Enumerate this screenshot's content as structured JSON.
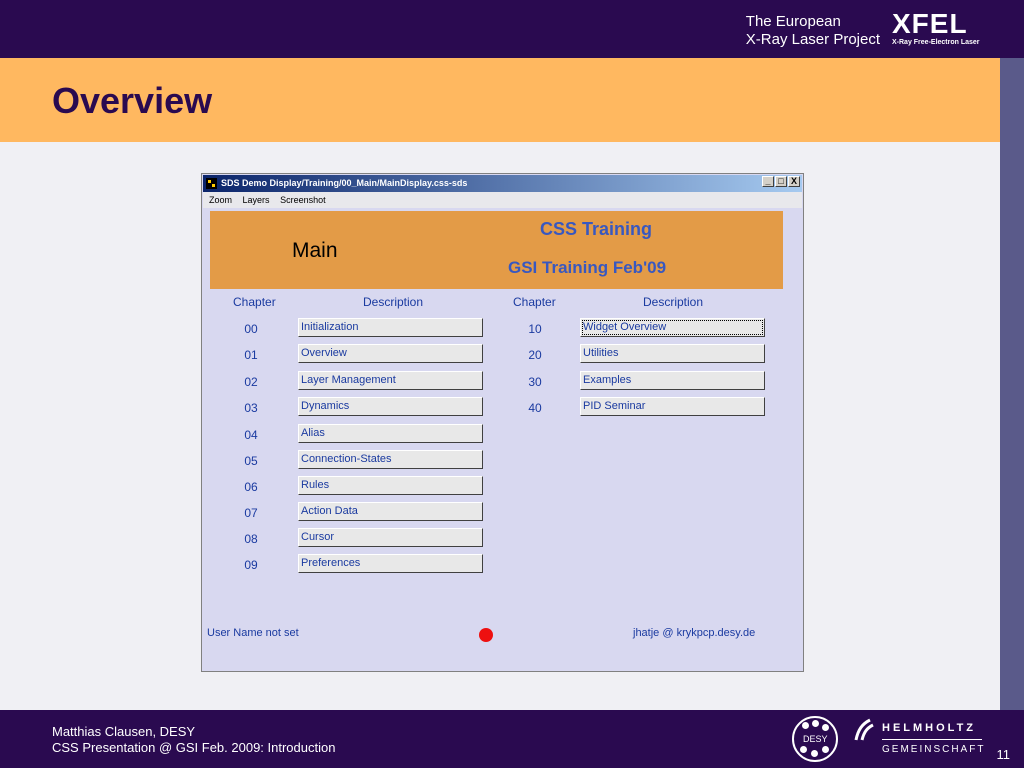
{
  "slide": {
    "title": "Overview",
    "brand_line1": "The European",
    "brand_line2": "X-Ray Laser Project",
    "xfel_big": "XFEL",
    "xfel_small": "X-Ray Free-Electron Laser",
    "footer_line1": "Matthias Clausen, DESY",
    "footer_line2": "CSS Presentation @ GSI Feb. 2009: Introduction",
    "page_number": "11",
    "desy_label": "DESY",
    "helmholtz_line1": "HELMHOLTZ",
    "helmholtz_line2": "GEMEINSCHAFT",
    "colors": {
      "header_bg": "#2a0a50",
      "title_bg": "#ffb860",
      "accent_text": "#1a3aa0",
      "banner_bg": "#e39b47",
      "led": "#ee1010"
    }
  },
  "window": {
    "title": "SDS Demo Display/Training/00_Main/MainDisplay.css-sds",
    "controls": [
      "_",
      "□",
      "X"
    ],
    "menu": [
      "Zoom",
      "Layers",
      "Screenshot"
    ],
    "banner_main": "Main",
    "banner_title1": "CSS Training",
    "banner_title2": "GSI Training Feb'09",
    "col_headers": [
      "Chapter",
      "Description",
      "Chapter",
      "Description"
    ],
    "left_rows": [
      {
        "chapter": "00",
        "label": "Initialization"
      },
      {
        "chapter": "01",
        "label": "Overview"
      },
      {
        "chapter": "02",
        "label": "Layer Management"
      },
      {
        "chapter": "03",
        "label": "Dynamics"
      },
      {
        "chapter": "04",
        "label": "Alias"
      },
      {
        "chapter": "05",
        "label": "Connection-States"
      },
      {
        "chapter": "06",
        "label": "Rules"
      },
      {
        "chapter": "07",
        "label": "Action Data"
      },
      {
        "chapter": "08",
        "label": "Cursor"
      },
      {
        "chapter": "09",
        "label": "Preferences"
      }
    ],
    "right_rows": [
      {
        "chapter": "10",
        "label": "Widget Overview"
      },
      {
        "chapter": "20",
        "label": "Utilities"
      },
      {
        "chapter": "30",
        "label": "Examples"
      },
      {
        "chapter": "40",
        "label": "PID Seminar"
      }
    ],
    "status_user": "User Name not set",
    "status_host": "jhatje @ krykpcp.desy.de"
  }
}
